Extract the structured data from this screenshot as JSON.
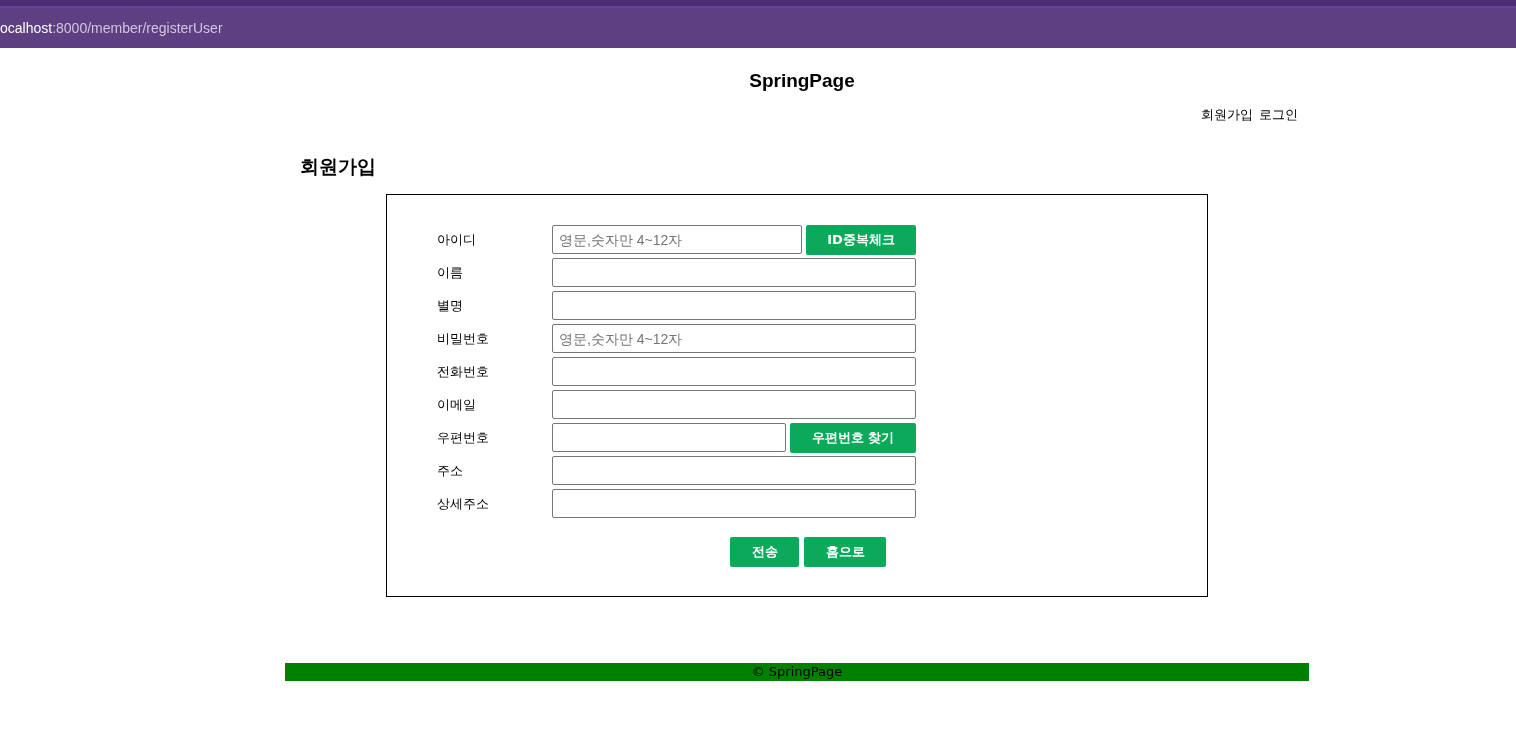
{
  "browser": {
    "url_host": "ocalhost",
    "url_path": ":8000/member/registerUser"
  },
  "site_title": "SpringPage",
  "nav": [
    "회원가입",
    "로그인"
  ],
  "heading": "회원가입",
  "fields": [
    {
      "label": "아이디",
      "placeholder": "영문,숫자만 4~12자",
      "button": "ID중복체크"
    },
    {
      "label": "이름"
    },
    {
      "label": "별명"
    },
    {
      "label": "비밀번호",
      "placeholder": "영문,숫자만 4~12자"
    },
    {
      "label": "전화번호"
    },
    {
      "label": "이메일"
    },
    {
      "label": "우편번호",
      "button": "우편번호 찾기"
    },
    {
      "label": "주소"
    },
    {
      "label": "상세주소"
    }
  ],
  "actions": [
    "전송",
    "홈으로"
  ],
  "footer": "© SpringPage"
}
